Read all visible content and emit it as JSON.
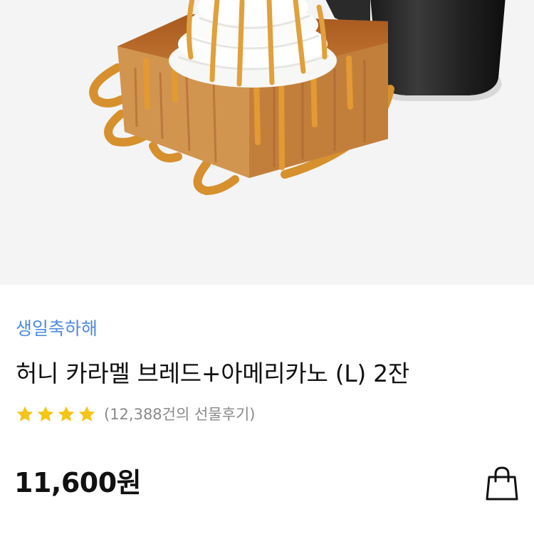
{
  "product": {
    "brand": "생일축하해",
    "title": "허니 카라멜 브레드+아메리카노 (L) 2잔",
    "rating_stars": 4,
    "review_count_text": "(12,388건의 선물후기)",
    "price": "11,600원"
  },
  "colors": {
    "brand_link": "#4f8ce0",
    "star": "#f5c517",
    "price_text": "#111111",
    "image_background": "#f4f4f4"
  },
  "icons": {
    "cart": "shopping-bag-icon",
    "rating": "star-icon"
  }
}
